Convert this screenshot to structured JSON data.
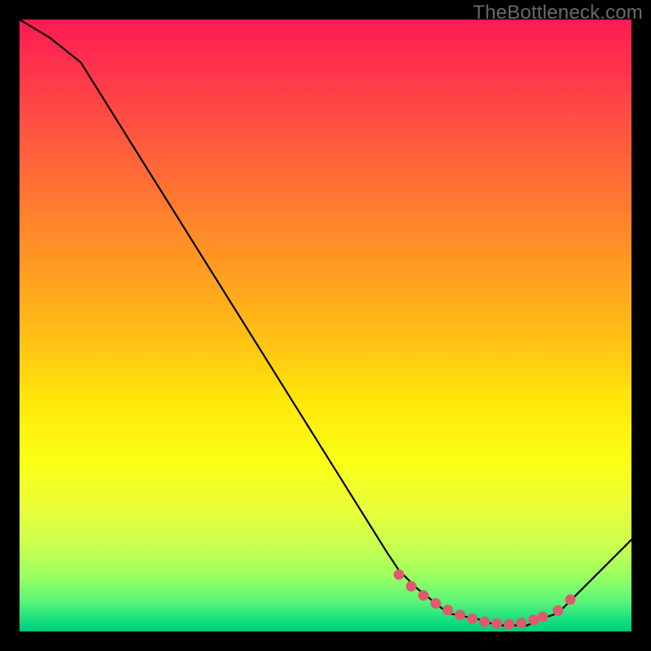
{
  "watermark": "TheBottleneck.com",
  "chart_data": {
    "type": "line",
    "title": "",
    "xlabel": "",
    "ylabel": "",
    "xlim": [
      0,
      100
    ],
    "ylim": [
      0,
      100
    ],
    "series": [
      {
        "name": "curve",
        "x": [
          0,
          5,
          10,
          15,
          20,
          25,
          30,
          35,
          40,
          45,
          50,
          55,
          60,
          62,
          65,
          70,
          75,
          78,
          80,
          83,
          85,
          88,
          90,
          95,
          100
        ],
        "y": [
          100,
          97,
          93,
          85,
          77,
          69,
          61,
          53,
          45,
          37,
          29,
          21,
          13,
          10,
          7,
          3,
          2,
          1,
          1,
          1,
          2,
          3,
          5,
          10,
          15
        ]
      }
    ],
    "markers": {
      "name": "highlight-dots",
      "color": "#e05a6f",
      "x": [
        62,
        64,
        66,
        68,
        70,
        72,
        74,
        76,
        78,
        80,
        82,
        84,
        85.5,
        88,
        90
      ],
      "y": [
        9.3,
        7.4,
        5.9,
        4.6,
        3.5,
        2.7,
        2.1,
        1.6,
        1.3,
        1.2,
        1.4,
        1.9,
        2.4,
        3.4,
        5.2
      ]
    }
  }
}
